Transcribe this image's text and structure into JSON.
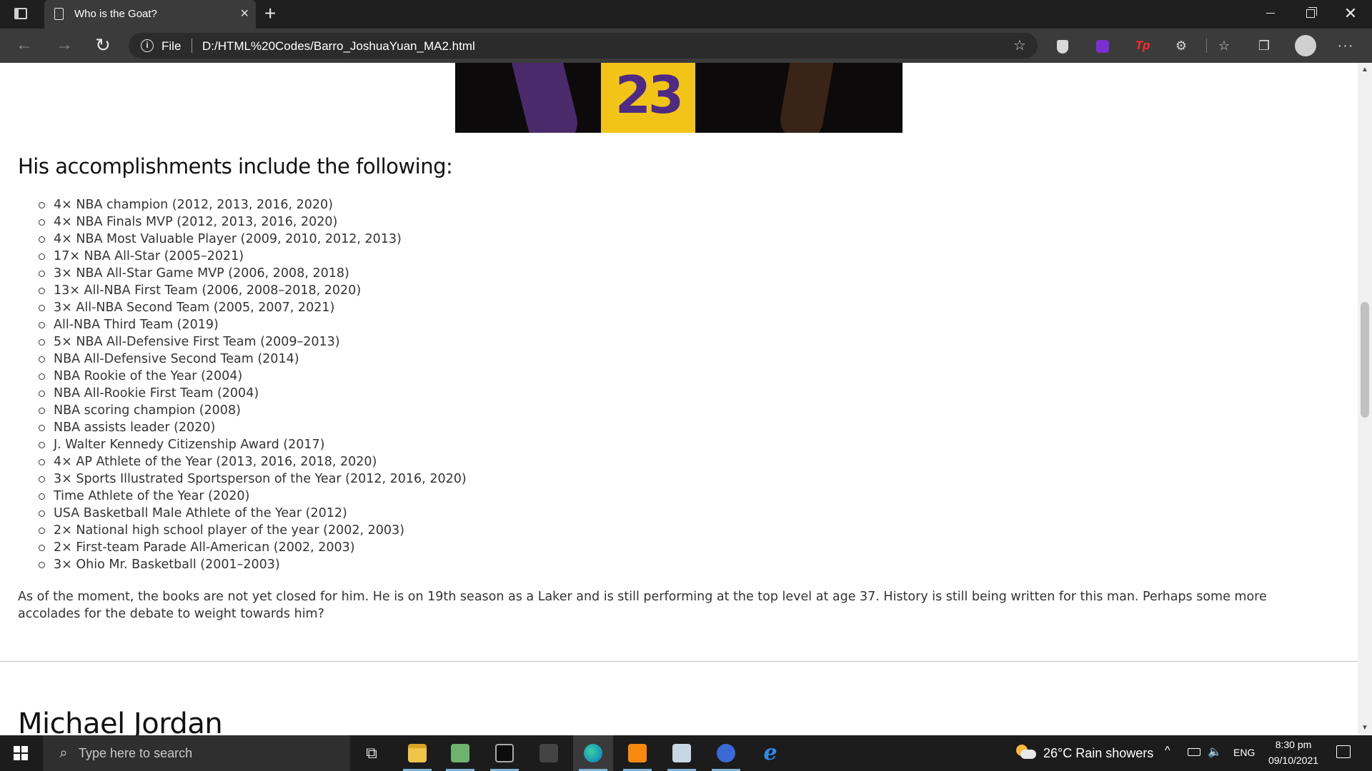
{
  "browser": {
    "tab_title": "Who is the Goat?",
    "tab_close": "×",
    "new_tab": "+",
    "address_scheme": "File",
    "address_url": "D:/HTML%20Codes/Barro_JoshuaYuan_MA2.html",
    "more_label": "···"
  },
  "page": {
    "hero_image_number": "23",
    "accomplishments_heading": "His accomplishments include the following:",
    "accomplishments": [
      "4× NBA champion (2012, 2013, 2016, 2020)",
      "4× NBA Finals MVP (2012, 2013, 2016, 2020)",
      "4× NBA Most Valuable Player (2009, 2010, 2012, 2013)",
      "17× NBA All-Star (2005–2021)",
      "3× NBA All-Star Game MVP (2006, 2008, 2018)",
      "13× All-NBA First Team (2006, 2008–2018, 2020)",
      "3× All-NBA Second Team (2005, 2007, 2021)",
      "All-NBA Third Team (2019)",
      "5× NBA All-Defensive First Team (2009–2013)",
      "NBA All-Defensive Second Team (2014)",
      "NBA Rookie of the Year (2004)",
      "NBA All-Rookie First Team (2004)",
      "NBA scoring champion (2008)",
      "NBA assists leader (2020)",
      "J. Walter Kennedy Citizenship Award (2017)",
      "4× AP Athlete of the Year (2013, 2016, 2018, 2020)",
      "3× Sports Illustrated Sportsperson of the Year (2012, 2016, 2020)",
      "Time Athlete of the Year (2020)",
      "USA Basketball Male Athlete of the Year (2012)",
      "2× National high school player of the year (2002, 2003)",
      "2× First-team Parade All-American (2002, 2003)",
      "3× Ohio Mr. Basketball (2001–2003)"
    ],
    "closing_paragraph": "As of the moment, the books are not yet closed for him. He is on 19th season as a Laker and is still performing at the top level at age 37. History is still being written for this man. Perhaps some more accolades for the debate to weight towards him?",
    "next_section_heading": "Michael Jordan"
  },
  "taskbar": {
    "search_placeholder": "Type here to search",
    "weather": "26°C  Rain showers",
    "language": "ENG",
    "time": "8:30 pm",
    "date": "09/10/2021"
  },
  "icons": {
    "accent_purple": "#4e2a84",
    "accent_gold": "#f2c418"
  }
}
